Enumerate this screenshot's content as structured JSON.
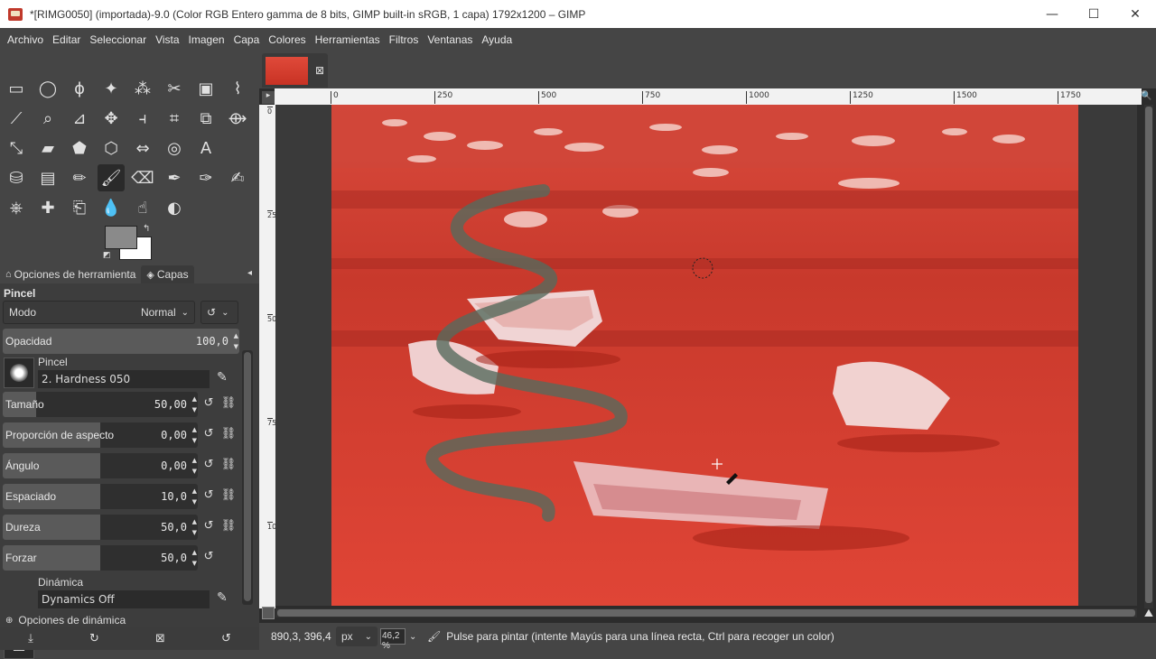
{
  "window": {
    "title": "*[RIMG0050] (importada)-9.0 (Color RGB Entero gamma de 8 bits, GIMP built-in sRGB, 1 capa) 1792x1200 – GIMP",
    "minimize": "—",
    "maximize": "☐",
    "close": "✕"
  },
  "menubar": [
    "Archivo",
    "Editar",
    "Seleccionar",
    "Vista",
    "Imagen",
    "Capa",
    "Colores",
    "Herramientas",
    "Filtros",
    "Ventanas",
    "Ayuda"
  ],
  "toolbox": {
    "icons": [
      "rect-select-icon",
      "ellipse-select-icon",
      "free-select-icon",
      "fuzzy-select-icon",
      "select-by-color-icon",
      "scissors-select-icon",
      "foreground-select-icon",
      "paths-icon",
      "color-picker-icon",
      "zoom-icon",
      "measure-icon",
      "move-icon",
      "align-icon",
      "crop-icon",
      "unified-transform-icon",
      "warp-transform-icon",
      "handle-transform-icon",
      "shear-icon",
      "cage-transform-icon",
      "perspective-icon",
      "flip-icon",
      "3d-transform-icon",
      "text-icon",
      "bucket-fill-icon",
      "gradient-icon",
      "pencil-icon",
      "paintbrush-icon",
      "eraser-icon",
      "airbrush-icon",
      "ink-icon",
      "mypaint-brush-icon",
      "clone-icon",
      "heal-icon",
      "perspective-clone-icon",
      "blur-icon",
      "smudge-icon",
      "dodge-burn-icon"
    ],
    "active_tool": "paintbrush-icon",
    "fg_color": "#8a8a8a",
    "bg_color": "#ffffff"
  },
  "dock": {
    "tab_options": "Opciones de herramienta",
    "tab_layers": "Capas"
  },
  "tool_options": {
    "title": "Pincel",
    "mode_label": "Modo",
    "mode_value": "Normal",
    "opacity_label": "Opacidad",
    "opacity_value": "100,0",
    "brush_label": "Pincel",
    "brush_value": "2. Hardness 050",
    "sliders": [
      {
        "label": "Tamaño",
        "value": "50,00",
        "fill": 0.17
      },
      {
        "label": "Proporción de aspecto",
        "value": "0,00",
        "fill": 0.5
      },
      {
        "label": "Ángulo",
        "value": "0,00",
        "fill": 0.5
      },
      {
        "label": "Espaciado",
        "value": "10,0",
        "fill": 0.5
      },
      {
        "label": "Dureza",
        "value": "50,0",
        "fill": 0.5
      },
      {
        "label": "Forzar",
        "value": "50,0",
        "fill": 0.5
      }
    ],
    "dynamics_label": "Dinámica",
    "dynamics_value": "Dynamics Off",
    "dynamics_options": "Opciones de dinámica"
  },
  "rulers": {
    "h_ticks": [
      "0",
      "250",
      "500",
      "750",
      "1000",
      "1250",
      "1500",
      "1750"
    ],
    "v_ticks": [
      "0",
      "250",
      "500",
      "750",
      "1000"
    ]
  },
  "statusbar": {
    "coords": "890,3, 396,4",
    "unit": "px",
    "zoom": "46,2 %",
    "message": "Pulse para pintar (intente Mayús para una línea recta, Ctrl para recoger un color)"
  }
}
